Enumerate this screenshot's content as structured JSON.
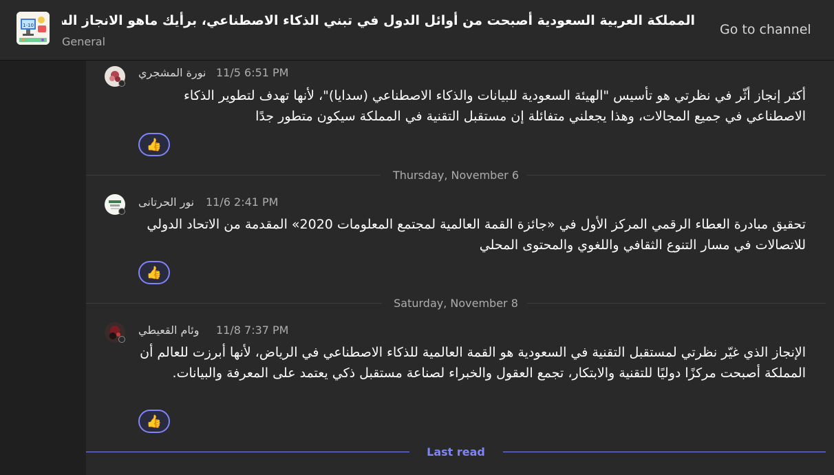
{
  "header": {
    "title": "المملكة العربية السعودية أصبحت من أوائل الدول في تبني الذكاء الاصطناعي، برأيك ماهو الانجاز السعودي...",
    "channel": "General",
    "go_to_channel": "Go to channel",
    "team_icon": "classroom-illustration-icon"
  },
  "messages": [
    {
      "author": "نورة المشجري",
      "time": "11/5 6:51 PM",
      "body": "أكثر إنجاز أثّر في نظرتي هو تأسيس \"الهيئة السعودية للبيانات والذكاء الاصطناعي (سدايا)\"، لأنها تهدف لتطوير الذكاء الاصطناعي في جميع المجالات، وهذا يجعلني متفائلة إن مستقبل التقنية في المملكة سيكون متطور جدًا",
      "reaction": "👍"
    },
    {
      "author": "نور الحرتانى",
      "time": "11/6 2:41 PM",
      "body": "تحقيق مبادرة العطاء الرقمي المركز الأول في «جائزة القمة العالمية لمجتمع المعلومات 2020» المقدمة من الاتحاد الدولي للاتصالات في مسار التنوع الثقافي واللغوي والمحتوى المحلي",
      "reaction": "👍"
    },
    {
      "author": "وئام القعيطي",
      "time": "11/8 7:37 PM",
      "body": "الإنجاز الذي غيّر نظرتي لمستقبل التقنية في السعودية هو القمة العالمية للذكاء الاصطناعي في الرياض، لأنها أبرزت للعالم أن المملكة أصبحت مركزًا دوليًا للتقنية والابتكار، تجمع العقول والخبراء لصناعة مستقبل ذكي يعتمد على المعرفة والبيانات.",
      "reaction": "👍"
    }
  ],
  "dividers": {
    "nov6": "Thursday, November 6",
    "nov8": "Saturday, November 8",
    "last_read": "Last read"
  },
  "colors": {
    "accent": "#7f85f5",
    "header_bg": "#292929",
    "thread_bg": "#292929"
  }
}
